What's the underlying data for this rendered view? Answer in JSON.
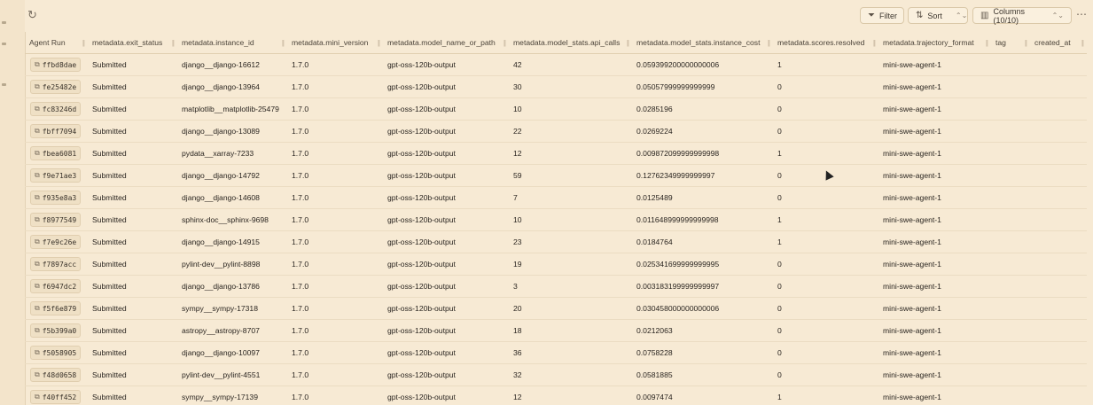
{
  "toolbar": {
    "refresh_icon": "refresh-icon",
    "filter_label": "Filter",
    "sort_label": "Sort",
    "columns_label": "Columns (10/10)",
    "more_label": "⋯"
  },
  "table": {
    "columns": [
      "Agent Run",
      "metadata.exit_status",
      "metadata.instance_id",
      "metadata.mini_version",
      "metadata.model_name_or_path",
      "metadata.model_stats.api_calls",
      "metadata.model_stats.instance_cost",
      "metadata.scores.resolved",
      "metadata.trajectory_format",
      "tag",
      "created_at"
    ],
    "rows": [
      [
        "ffbd8dae",
        "Submitted",
        "django__django-16612",
        "1.7.0",
        "gpt-oss-120b-output",
        "42",
        "0.059399200000000006",
        "1",
        "mini-swe-agent-1",
        "",
        ""
      ],
      [
        "fe25482e",
        "Submitted",
        "django__django-13964",
        "1.7.0",
        "gpt-oss-120b-output",
        "30",
        "0.05057999999999999",
        "0",
        "mini-swe-agent-1",
        "",
        ""
      ],
      [
        "fc83246d",
        "Submitted",
        "matplotlib__matplotlib-25479",
        "1.7.0",
        "gpt-oss-120b-output",
        "10",
        "0.0285196",
        "0",
        "mini-swe-agent-1",
        "",
        ""
      ],
      [
        "fbff7094",
        "Submitted",
        "django__django-13089",
        "1.7.0",
        "gpt-oss-120b-output",
        "22",
        "0.0269224",
        "0",
        "mini-swe-agent-1",
        "",
        ""
      ],
      [
        "fbea6081",
        "Submitted",
        "pydata__xarray-7233",
        "1.7.0",
        "gpt-oss-120b-output",
        "12",
        "0.009872099999999998",
        "1",
        "mini-swe-agent-1",
        "",
        ""
      ],
      [
        "f9e71ae3",
        "Submitted",
        "django__django-14792",
        "1.7.0",
        "gpt-oss-120b-output",
        "59",
        "0.12762349999999997",
        "0",
        "mini-swe-agent-1",
        "",
        ""
      ],
      [
        "f935e8a3",
        "Submitted",
        "django__django-14608",
        "1.7.0",
        "gpt-oss-120b-output",
        "7",
        "0.0125489",
        "0",
        "mini-swe-agent-1",
        "",
        ""
      ],
      [
        "f8977549",
        "Submitted",
        "sphinx-doc__sphinx-9698",
        "1.7.0",
        "gpt-oss-120b-output",
        "10",
        "0.011648999999999998",
        "1",
        "mini-swe-agent-1",
        "",
        ""
      ],
      [
        "f7e9c26e",
        "Submitted",
        "django__django-14915",
        "1.7.0",
        "gpt-oss-120b-output",
        "23",
        "0.0184764",
        "1",
        "mini-swe-agent-1",
        "",
        ""
      ],
      [
        "f7897acc",
        "Submitted",
        "pylint-dev__pylint-8898",
        "1.7.0",
        "gpt-oss-120b-output",
        "19",
        "0.025341699999999995",
        "0",
        "mini-swe-agent-1",
        "",
        ""
      ],
      [
        "f6947dc2",
        "Submitted",
        "django__django-13786",
        "1.7.0",
        "gpt-oss-120b-output",
        "3",
        "0.003183199999999997",
        "0",
        "mini-swe-agent-1",
        "",
        ""
      ],
      [
        "f5f6e879",
        "Submitted",
        "sympy__sympy-17318",
        "1.7.0",
        "gpt-oss-120b-output",
        "20",
        "0.030458000000000006",
        "0",
        "mini-swe-agent-1",
        "",
        ""
      ],
      [
        "f5b399a0",
        "Submitted",
        "astropy__astropy-8707",
        "1.7.0",
        "gpt-oss-120b-output",
        "18",
        "0.0212063",
        "0",
        "mini-swe-agent-1",
        "",
        ""
      ],
      [
        "f5058905",
        "Submitted",
        "django__django-10097",
        "1.7.0",
        "gpt-oss-120b-output",
        "36",
        "0.0758228",
        "0",
        "mini-swe-agent-1",
        "",
        ""
      ],
      [
        "f48d0658",
        "Submitted",
        "pylint-dev__pylint-4551",
        "1.7.0",
        "gpt-oss-120b-output",
        "32",
        "0.0581885",
        "0",
        "mini-swe-agent-1",
        "",
        ""
      ],
      [
        "f40ff452",
        "Submitted",
        "sympy__sympy-17139",
        "1.7.0",
        "gpt-oss-120b-output",
        "12",
        "0.0097474",
        "1",
        "mini-swe-agent-1",
        "",
        ""
      ]
    ]
  }
}
